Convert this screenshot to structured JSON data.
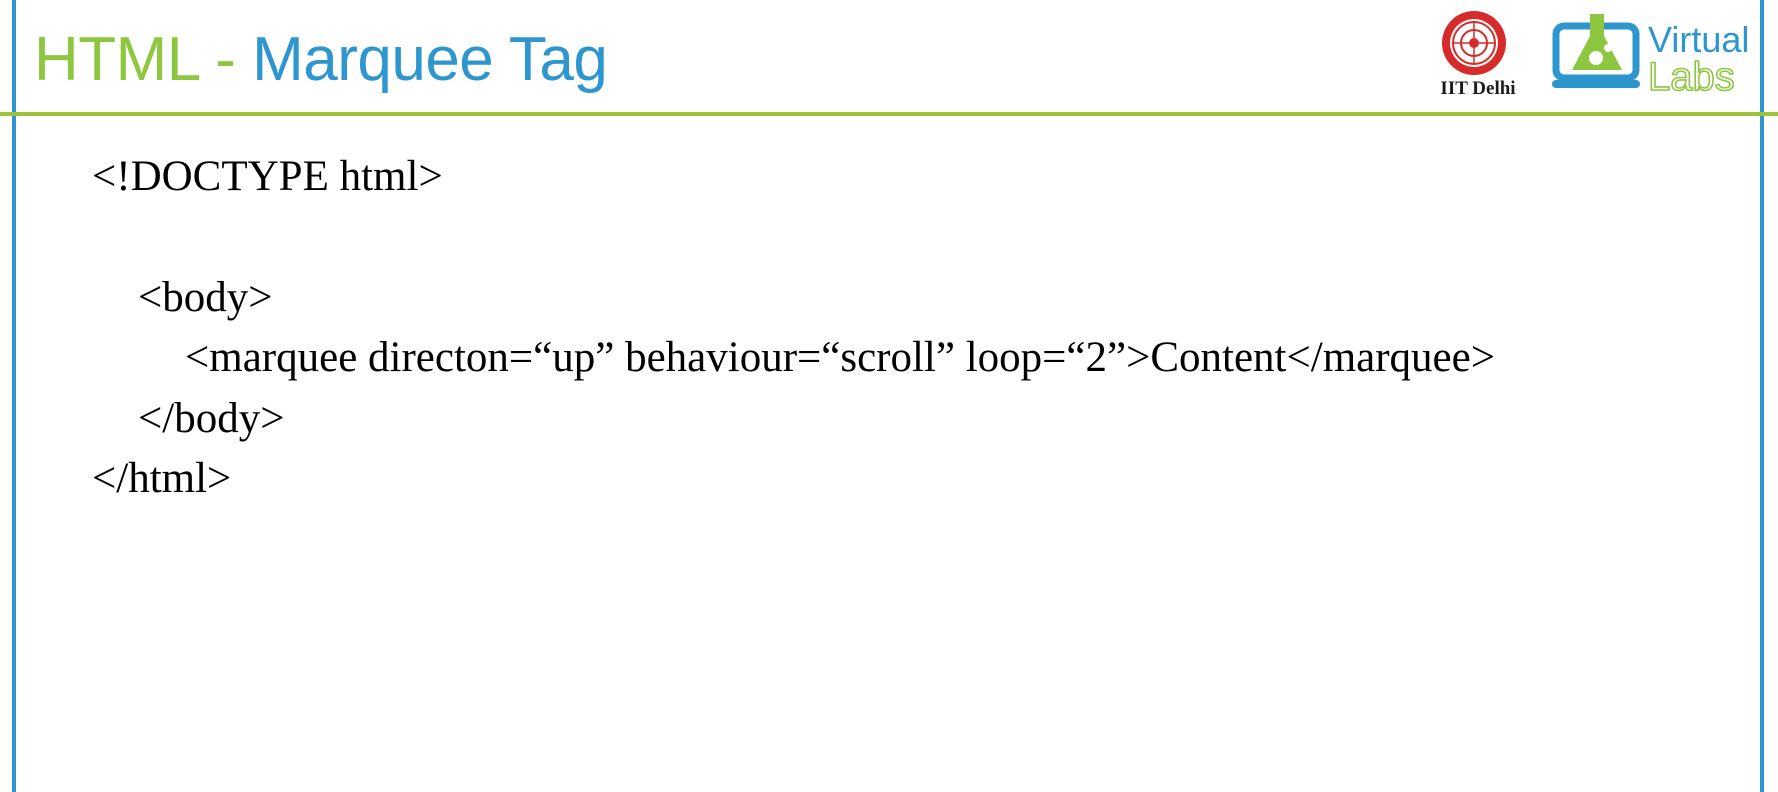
{
  "slide": {
    "title_part1": "HTML - ",
    "title_part2": "Marquee Tag",
    "logos": {
      "iit_caption": "IIT Delhi",
      "virtual_labs_word1": "Virtual",
      "virtual_labs_word2": "Labs"
    },
    "code_lines": [
      "<!DOCTYPE html>",
      "",
      "<body>",
      "<marquee directon=“up” behaviour=“scroll” loop=“2”>Content</marquee>",
      "</body>",
      "</html>"
    ]
  },
  "colors": {
    "title_green": "#8dc63f",
    "title_blue": "#2e96cf",
    "border_blue": "#2f95cf",
    "rule_green": "#9cc33a",
    "iit_red": "#d52b2b"
  }
}
